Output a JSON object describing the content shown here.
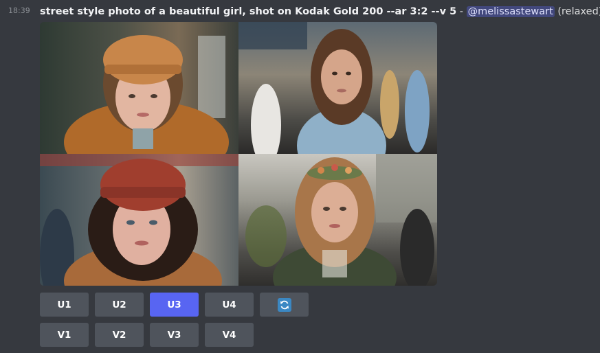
{
  "message": {
    "timestamp": "18:39",
    "prompt": "street style photo of a beautiful girl, shot on Kodak Gold 200 --ar 3:2 --v 5",
    "separator": " - ",
    "mention": "@melissastewart",
    "mode": " (relaxed)"
  },
  "images": [
    {
      "semantic": "girl-beige-hat-photo"
    },
    {
      "semantic": "girl-denim-shirt-street-photo"
    },
    {
      "semantic": "girl-red-hat-curly-hair-photo"
    },
    {
      "semantic": "girl-flower-crown-photo"
    }
  ],
  "buttons": {
    "row1": [
      "U1",
      "U2",
      "U3",
      "U4"
    ],
    "row2": [
      "V1",
      "V2",
      "V3",
      "V4"
    ],
    "active": "U3",
    "reroll_icon": "reroll-icon"
  },
  "colors": {
    "background": "#36393f",
    "button": "#4f545c",
    "button_active": "#5865f2",
    "mention_bg": "#5865f2",
    "reroll": "#3b88c3"
  }
}
